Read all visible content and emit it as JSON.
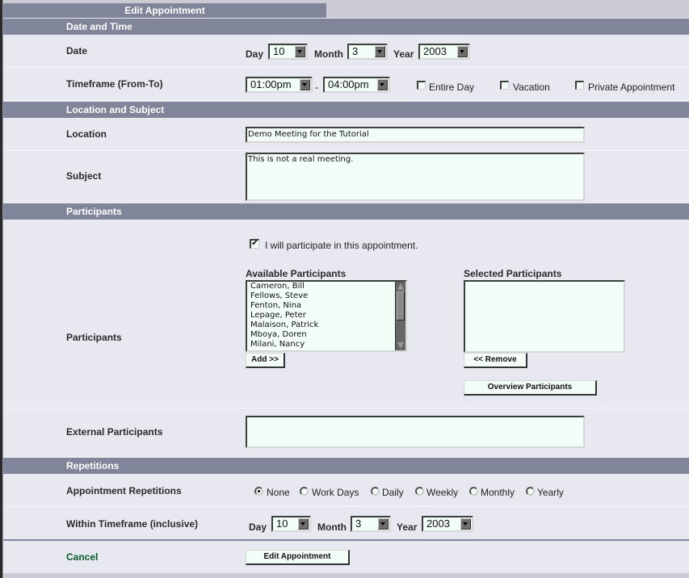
{
  "page_title": "Edit Appointment",
  "sections": {
    "date_time": "Date and Time",
    "location_subject": "Location and Subject",
    "participants": "Participants",
    "repetitions": "Repetitions"
  },
  "date_row": {
    "label": "Date",
    "day_label": "Day",
    "day_value": "10",
    "month_label": "Month",
    "month_value": "3",
    "year_label": "Year",
    "year_value": "2003"
  },
  "timeframe_row": {
    "label": "Timeframe (From-To)",
    "from_value": "01:00pm",
    "separator": "-",
    "to_value": "04:00pm",
    "options": [
      {
        "label": "Entire Day",
        "checked": false
      },
      {
        "label": "Vacation",
        "checked": false
      },
      {
        "label": "Private Appointment",
        "checked": false
      }
    ]
  },
  "location_row": {
    "label": "Location",
    "value": "Demo Meeting for the Tutorial"
  },
  "subject_row": {
    "label": "Subject",
    "value": "This is not a real meeting."
  },
  "participants_row": {
    "label": "Participants",
    "self_participate_label": "I will participate in this appointment.",
    "self_participate_checked": true,
    "self_participate_mark": "✔",
    "available_title": "Available Participants",
    "available": [
      "Cameron, Bill",
      "Fellows, Steve",
      "Fenton, Nina",
      "Lepage, Peter",
      "Malaison, Patrick",
      "Mboya, Doren",
      "Milani, Nancy"
    ],
    "add_button": "Add >>",
    "selected_title": "Selected Participants",
    "selected": [],
    "remove_button": "<< Remove",
    "overview_button": "Overview Participants"
  },
  "external_row": {
    "label": "External Participants",
    "value": ""
  },
  "repetitions_row": {
    "label": "Appointment Repetitions",
    "options": [
      "None",
      "Work Days",
      "Daily",
      "Weekly",
      "Monthly",
      "Yearly"
    ],
    "selected": "None"
  },
  "within_row": {
    "label": "Within Timeframe (inclusive)",
    "day_label": "Day",
    "day_value": "10",
    "month_label": "Month",
    "month_value": "3",
    "year_label": "Year",
    "year_value": "2003"
  },
  "actions": {
    "cancel_label": "Cancel",
    "submit_label": "Edit Appointment"
  }
}
